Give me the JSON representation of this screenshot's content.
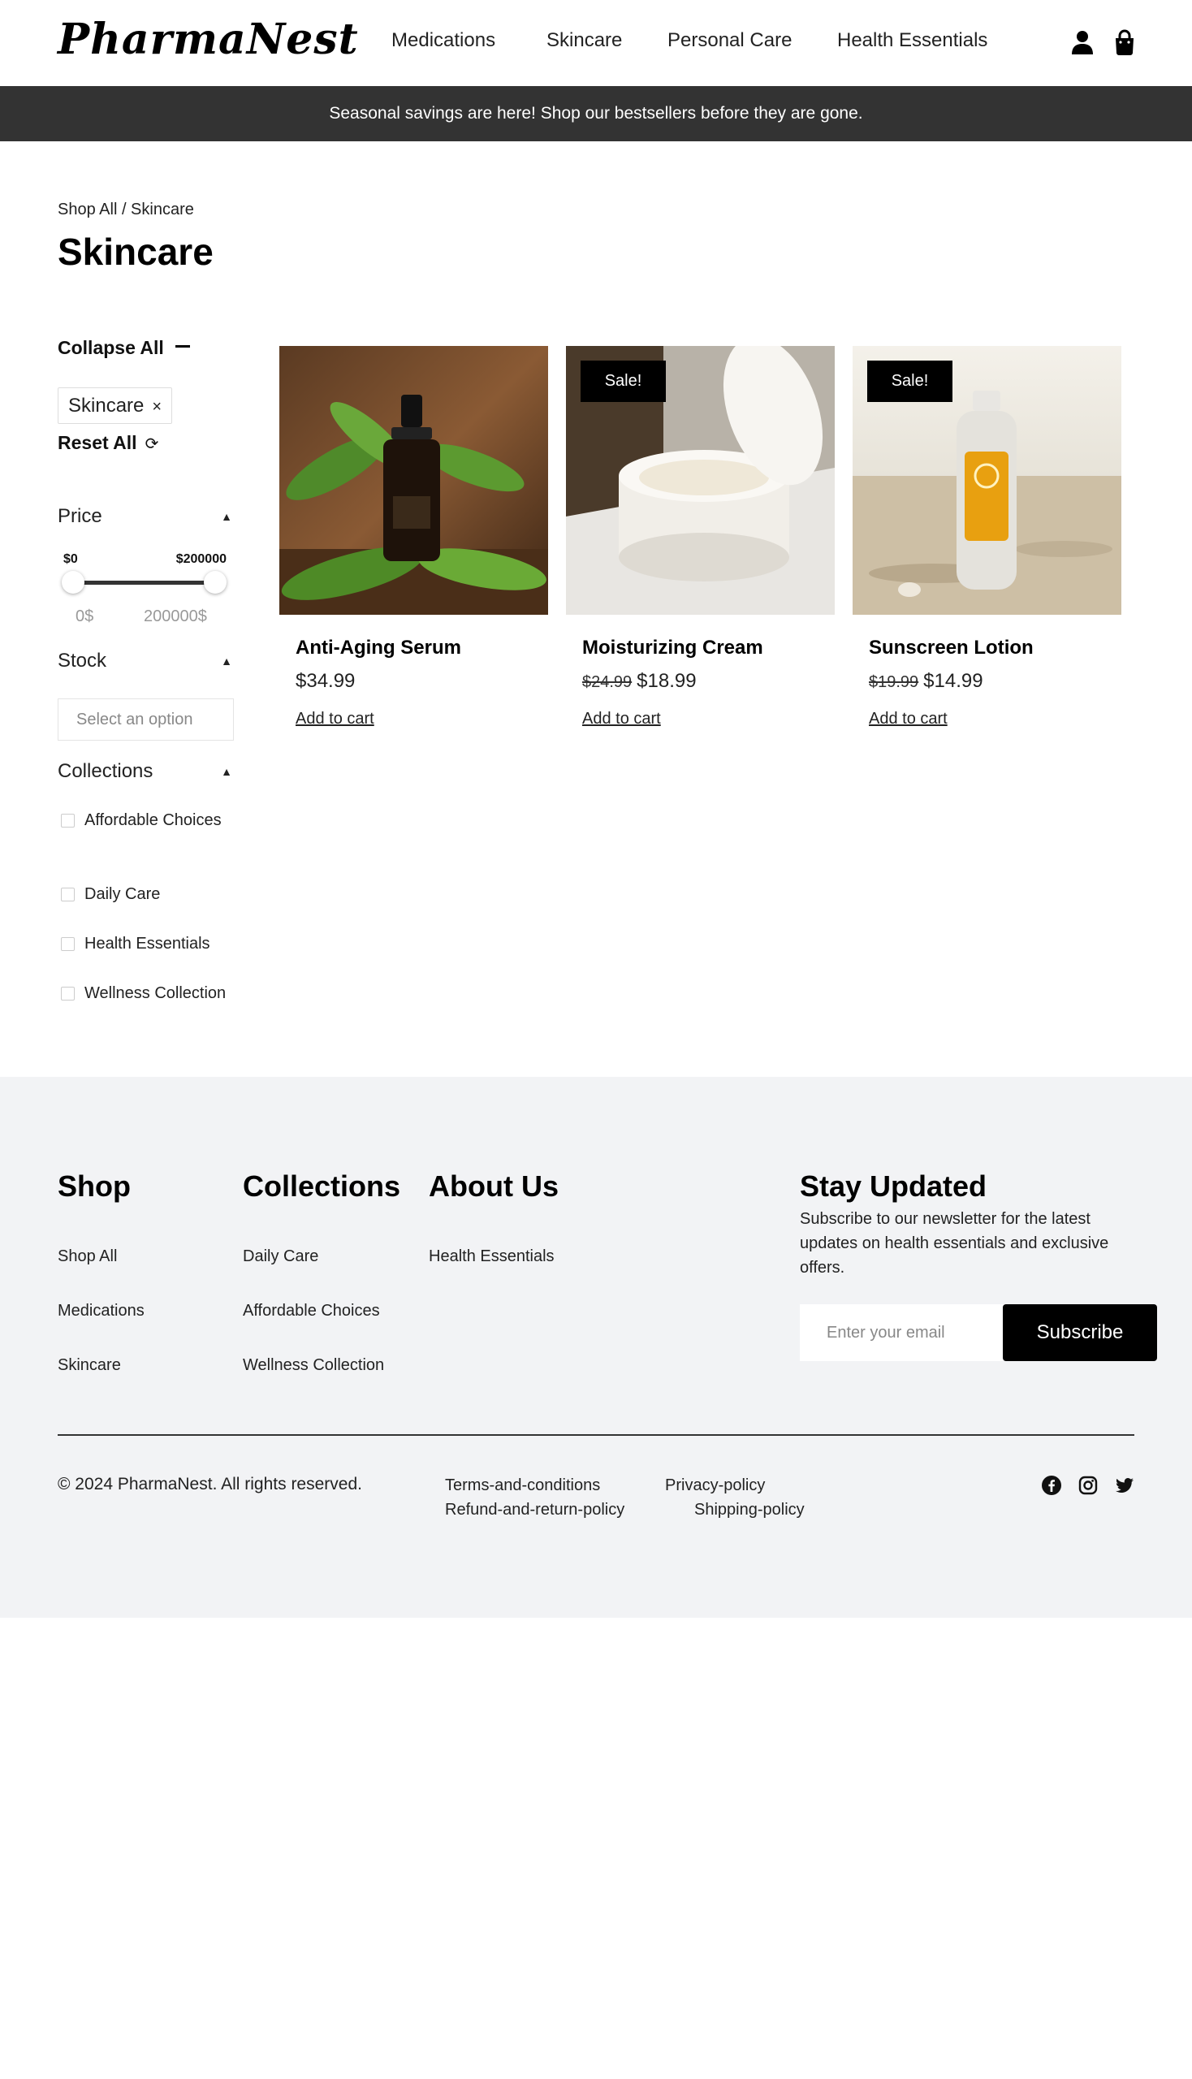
{
  "header": {
    "logo": "PharmaNest",
    "nav": [
      "Medications",
      "Skincare",
      "Personal Care",
      "Health Essentials"
    ],
    "icons": [
      "user-icon",
      "shopping-bag-icon"
    ]
  },
  "banner": {
    "text": "Seasonal savings are here! Shop our bestsellers before they are gone."
  },
  "breadcrumb": "Shop All / Skincare",
  "page_title": "Skincare",
  "filters": {
    "collapse_all": "Collapse All",
    "active_chip": "Skincare",
    "chip_remove": "×",
    "reset_all": "Reset All",
    "price": {
      "title": "Price",
      "min_label": "$0",
      "max_label": "$200000",
      "range_min": "0$",
      "range_max": "200000$"
    },
    "stock": {
      "title": "Stock",
      "placeholder": "Select an option"
    },
    "collections": {
      "title": "Collections",
      "items": [
        "Affordable Choices",
        "Daily Care",
        "Health Essentials",
        "Wellness Collection"
      ]
    }
  },
  "products": [
    {
      "name": "Anti-Aging Serum",
      "old_price": "",
      "price": "$34.99",
      "sale_badge": "",
      "cta": "Add to cart"
    },
    {
      "name": "Moisturizing Cream",
      "old_price": "$24.99",
      "price": "$18.99",
      "sale_badge": "Sale!",
      "cta": "Add to cart"
    },
    {
      "name": "Sunscreen Lotion",
      "old_price": "$19.99",
      "price": "$14.99",
      "sale_badge": "Sale!",
      "cta": "Add to cart"
    }
  ],
  "footer": {
    "shop": {
      "title": "Shop",
      "links": [
        "Shop All",
        "Medications",
        "Skincare"
      ]
    },
    "collections": {
      "title": "Collections",
      "links": [
        "Daily Care",
        "Affordable Choices",
        "Wellness Collection"
      ]
    },
    "about": {
      "title": "About Us",
      "links": [
        "Health Essentials"
      ]
    },
    "newsletter": {
      "title": "Stay Updated",
      "text": "Subscribe to our newsletter for the latest updates on health essentials and exclusive offers.",
      "placeholder": "Enter your email",
      "button": "Subscribe"
    },
    "copyright": "© 2024 PharmaNest. All rights reserved.",
    "legal": [
      "Terms-and-conditions",
      "Privacy-policy",
      "Refund-and-return-policy",
      "Shipping-policy"
    ],
    "social": [
      "facebook-icon",
      "instagram-icon",
      "twitter-icon"
    ]
  }
}
